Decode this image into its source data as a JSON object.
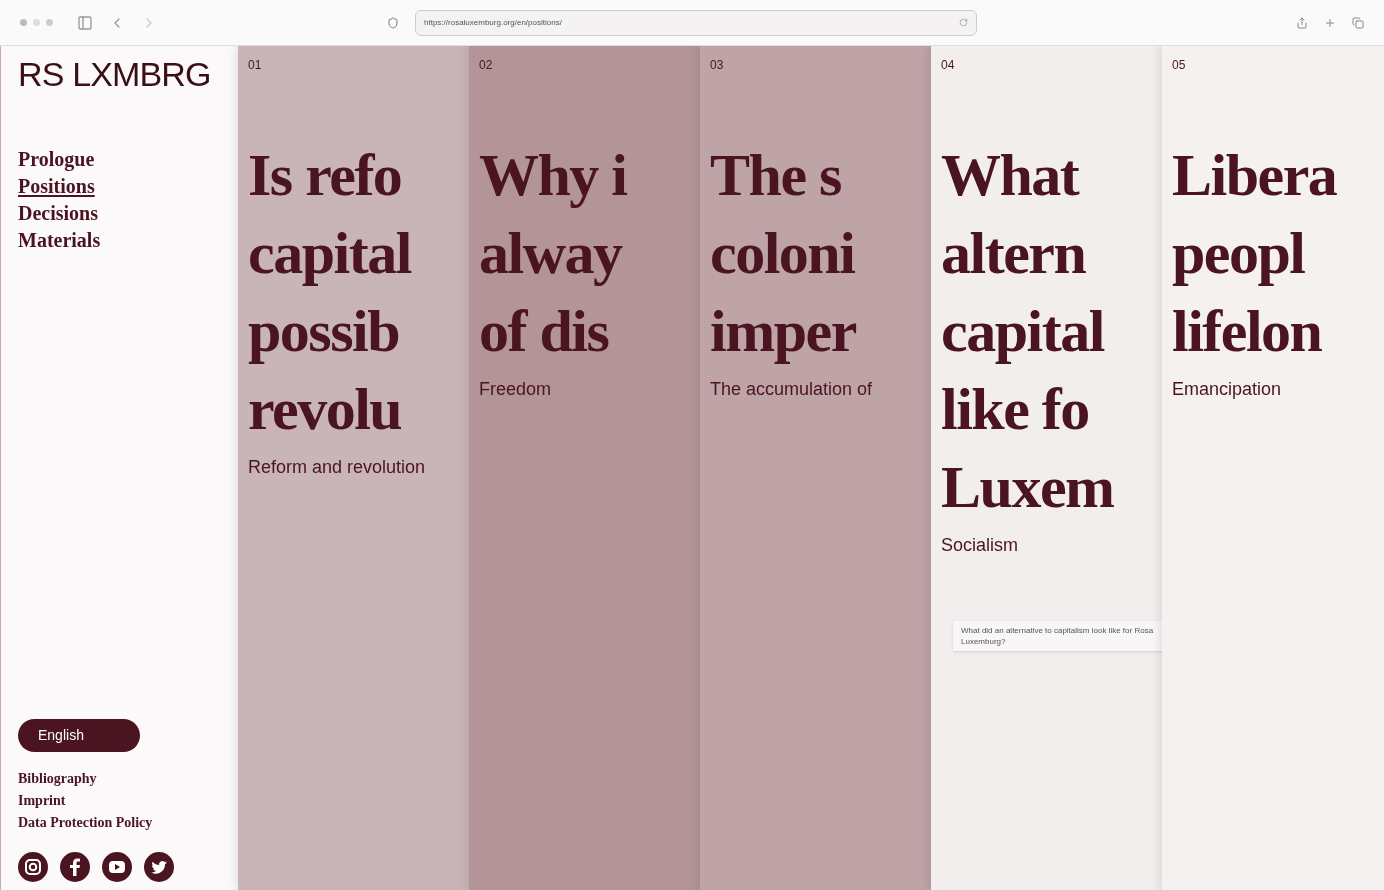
{
  "browser": {
    "url": "https://rosaluxemburg.org/en/positions/"
  },
  "logo": "RS LXMBRG",
  "nav": [
    {
      "label": "Prologue",
      "selected": false
    },
    {
      "label": "Positions",
      "selected": true
    },
    {
      "label": "Decisions",
      "selected": false
    },
    {
      "label": "Materials",
      "selected": false
    }
  ],
  "language": "English",
  "footer_links": [
    "Bibliography",
    "Imprint",
    "Data Protection Policy"
  ],
  "columns": [
    {
      "number": "01",
      "title_lines": [
        "Is refo",
        "capital",
        "possib",
        "revolu"
      ],
      "subtitle": "Reform and revolution",
      "color": "#c9b5b7"
    },
    {
      "number": "02",
      "title_lines": [
        "Why i",
        "alway",
        "of dis"
      ],
      "subtitle": "Freedom",
      "color": "#b39599"
    },
    {
      "number": "03",
      "title_lines": [
        "The s",
        "coloni",
        "imper"
      ],
      "subtitle": "The accumulation of",
      "color": "#bea3a7"
    },
    {
      "number": "04",
      "title_lines": [
        "What",
        "altern",
        "capital",
        "like fo",
        "Luxem"
      ],
      "subtitle": "Socialism",
      "color": "#f2eeed",
      "tooltip": "What did an alternative to capitalism look like for Rosa Luxemburg?"
    },
    {
      "number": "05",
      "title_lines": [
        "Libera",
        "peopl",
        "lifelon"
      ],
      "subtitle": "Emancipation",
      "color": "#f4f1f0"
    }
  ]
}
